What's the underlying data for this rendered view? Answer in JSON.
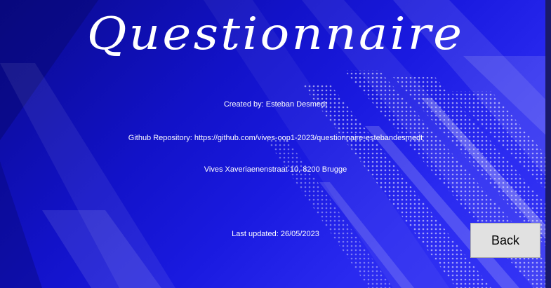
{
  "header": {
    "title": "Questionnaire"
  },
  "info": {
    "created_by": "Created by: Esteban Desmedt",
    "repository": "Github Repository: https://github.com/vives-oop1-2023/questionnaire-estebandesmedt",
    "address": "Vives Xaveriaenenstraat 10, 8200 Brugge",
    "last_updated": "Last updated: 26/05/2023"
  },
  "actions": {
    "back_label": "Back"
  },
  "colors": {
    "background_dark": "#0a0a8c",
    "background_light": "#3535f5",
    "text": "#ffffff",
    "button_bg": "#e1e1e1"
  }
}
